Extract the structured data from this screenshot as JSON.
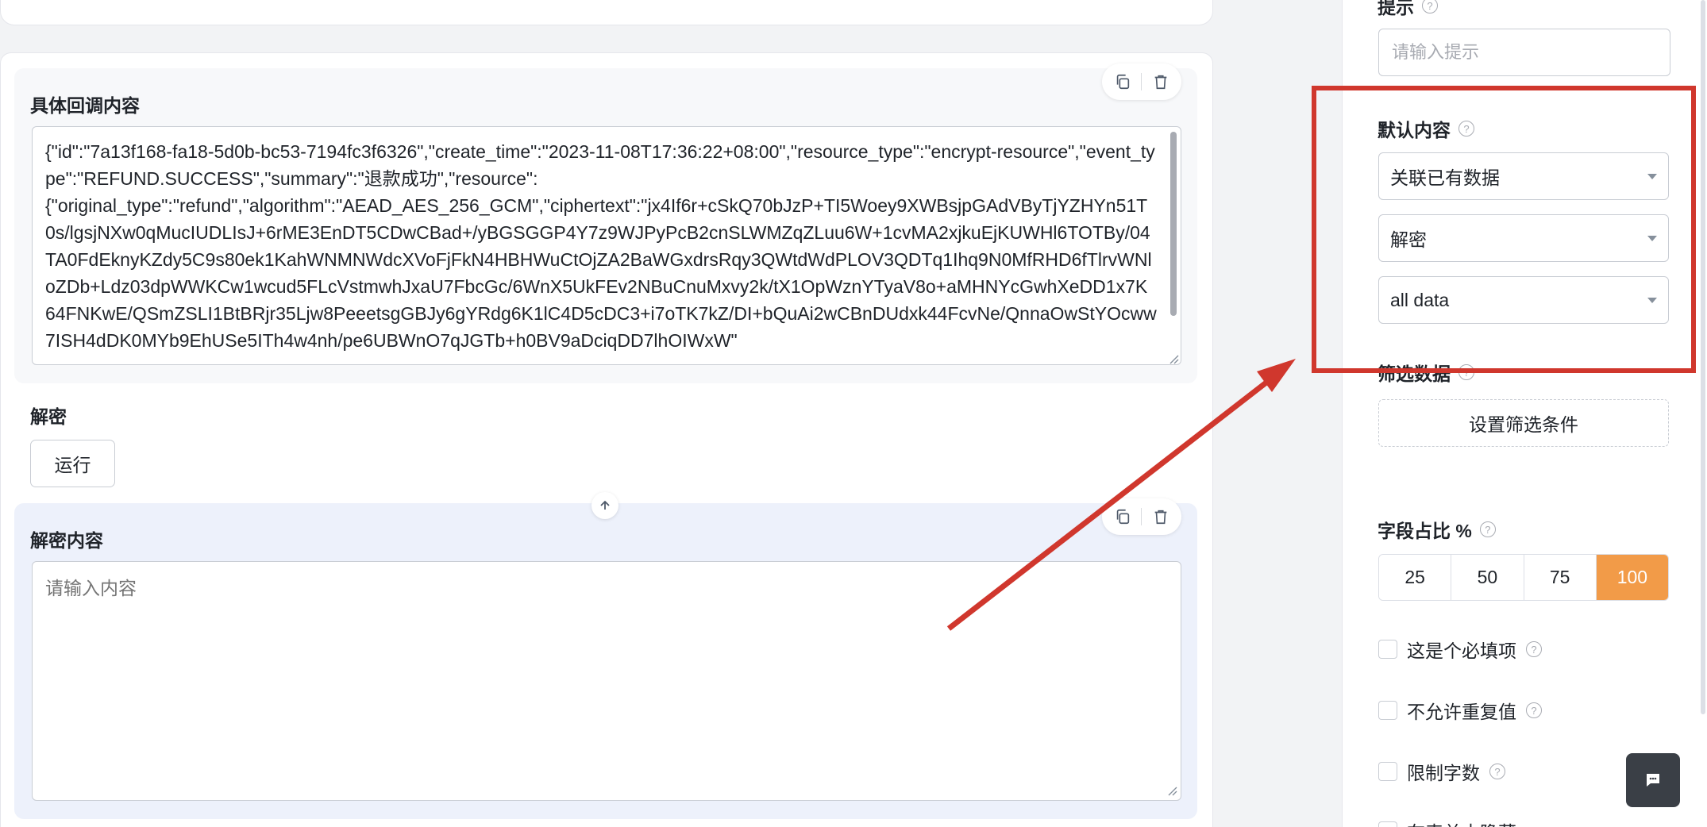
{
  "left": {
    "callback_block": {
      "title": "具体回调内容",
      "content": "{\"id\":\"7a13f168-fa18-5d0b-bc53-7194fc3f6326\",\"create_time\":\"2023-11-08T17:36:22+08:00\",\"resource_type\":\"encrypt-resource\",\"event_type\":\"REFUND.SUCCESS\",\"summary\":\"退款成功\",\"resource\":\n{\"original_type\":\"refund\",\"algorithm\":\"AEAD_AES_256_GCM\",\"ciphertext\":\"jx4If6r+cSkQ70bJzP+TI5Woey9XWBsjpGAdVByTjYZHYn51T0s/lgsjNXw0qMucIUDLIsJ+6rME3EnDT5CDwCBad+/yBGSGGP4Y7z9WJPyPcB2cnSLWMZqZLuu6W+1cvMA2xjkuEjKUWHl6TOTBy/04TA0FdEknyKZdy5C9s80ek1KahWNMNWdcXVoFjFkN4HBHWuCtOjZA2BaWGxdrsRqy3QWtdWdPLOV3QDTq1Ihq9N0MfRHD6fTlrvWNloZDb+Ldz03dpWWKCw1wcud5FLcVstmwhJxaU7FbcGc/6WnX5UkFEv2NBuCnuMxvy2k/tX1OpWznYTyaV8o+aMHNYcGwhXeDD1x7K64FNKwE/QSmZSLI1BtBRjr35Ljw8PeeetsgGBJy6gYRdg6K1lC4D5cDC3+i7oTK7kZ/DI+bQuAi2wCBnDUdxk44FcvNe/QnnaOwStYOcww7ISH4dDK0MYb9EhUSe5ITh4w4nh/pe6UBWnO7qJGTb+h0BV9aDciqDD7lhOIWxW\""
    },
    "decrypt_section": {
      "label": "解密",
      "run_button": "运行"
    },
    "decrypt_block": {
      "title": "解密内容",
      "placeholder": "请输入内容"
    }
  },
  "panel": {
    "hint": {
      "label": "提示",
      "placeholder": "请输入提示"
    },
    "default_content": {
      "label": "默认内容",
      "select1": "关联已有数据",
      "select2": "解密",
      "select3": "all data"
    },
    "filter": {
      "label": "筛选数据",
      "button": "设置筛选条件"
    },
    "ratio": {
      "label": "字段占比 %",
      "options": [
        "25",
        "50",
        "75",
        "100"
      ],
      "selected": "100"
    },
    "checkboxes": [
      "这是个必填项",
      "不允许重复值",
      "限制字数",
      "在表单中隐藏"
    ]
  },
  "colors": {
    "accent": "#f29b48",
    "annotation": "#d0372d",
    "blue_block": "#edf1fb"
  }
}
